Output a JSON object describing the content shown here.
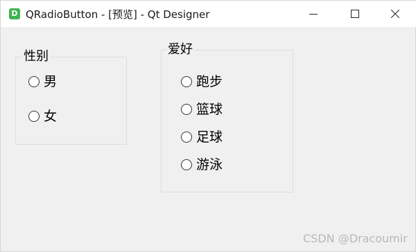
{
  "window": {
    "title": "QRadioButton - [预览] - Qt Designer",
    "app_icon_letter": "D"
  },
  "gender_group": {
    "title": "性别",
    "options": [
      "男",
      "女"
    ]
  },
  "hobby_group": {
    "title": "爱好",
    "options": [
      "跑步",
      "篮球",
      "足球",
      "游泳"
    ]
  },
  "watermark": "CSDN @Dracoumir",
  "colors": {
    "app_icon": "#3fb34f",
    "background": "#f0f0f0",
    "titlebar": "#ffffff"
  }
}
